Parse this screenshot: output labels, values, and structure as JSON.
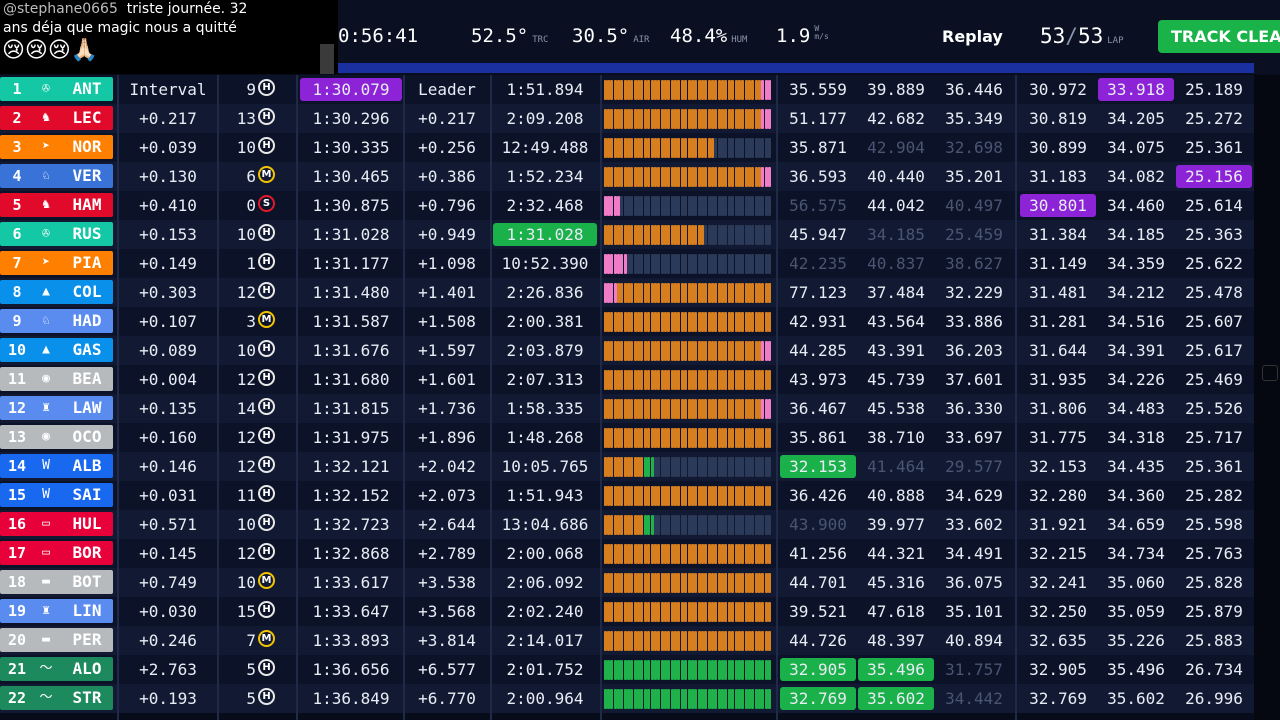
{
  "chat": {
    "user": "@stephane0665",
    "message_line1": "triste journée. 32",
    "message_line2": "ans déja que magic nous a quitté",
    "emojis": "😢😢😢🙏🏻"
  },
  "topbar": {
    "session_time": "0:56:41",
    "track_temp": "52.5°",
    "track_temp_unit": "TRC",
    "air_temp": "30.5°",
    "air_temp_unit": "AIR",
    "humidity": "48.4%",
    "humidity_unit": "HUM",
    "wind": "1.9",
    "wind_unit_top": "W",
    "wind_unit_bottom": "m/s",
    "mode_label": "Replay",
    "lap_current": "53",
    "lap_separator": "/",
    "lap_total": "53",
    "lap_unit": "LAP",
    "track_status_button": "TRACK CLEAR"
  },
  "colors": {
    "mercedes": "#14c8a6",
    "ferrari": "#e10a2a",
    "mclaren": "#ff8000",
    "redbull": "#3a73d8",
    "alpine": "#0890ea",
    "haas": "#b6babd",
    "racingbulls": "#5a8cf0",
    "williams": "#1868f0",
    "sauber": "#e8003a",
    "astonmartin": "#1d8a5e",
    "purple": "#8d23d6",
    "green": "#1ab04a",
    "mini_orange": "#d77f1f",
    "mini_pink": "#f07cc8",
    "mini_green": "#1fb24a",
    "mini_empty": "#2c3a5a",
    "tyre_hard": "#e8e8e8",
    "tyre_medium": "#f2c300",
    "tyre_soft": "#e01a2a"
  },
  "drivers": [
    {
      "pos": "1",
      "code": "ANT",
      "team": "mercedes",
      "logo": "✇",
      "interval": "Interval",
      "stint": "9",
      "tyre": "H",
      "best": "1:30.079",
      "best_hl": "purple",
      "gap": "Leader",
      "last": "1:51.894",
      "last_hl": "",
      "minis": "",
      "s1": "35.559",
      "s2": "39.889",
      "s3": "36.446",
      "s1_hl": "",
      "s2_hl": "",
      "s3_hl": "",
      "s1_f": false,
      "s2_f": false,
      "s3_f": false,
      "b1": "30.972",
      "b2": "33.918",
      "b3": "25.189",
      "b1_hl": "",
      "b2_hl": "purple",
      "b3_hl": ""
    },
    {
      "pos": "2",
      "code": "LEC",
      "team": "ferrari",
      "logo": "♞",
      "interval": "+0.217",
      "stint": "13",
      "tyre": "H",
      "best": "1:30.296",
      "best_hl": "",
      "gap": "+0.217",
      "last": "2:09.208",
      "last_hl": "",
      "minis": "",
      "s1": "51.177",
      "s2": "42.682",
      "s3": "35.349",
      "s1_hl": "",
      "s2_hl": "",
      "s3_hl": "",
      "s1_f": false,
      "s2_f": false,
      "s3_f": false,
      "b1": "30.819",
      "b2": "34.205",
      "b3": "25.272",
      "b1_hl": "",
      "b2_hl": "",
      "b3_hl": ""
    },
    {
      "pos": "3",
      "code": "NOR",
      "team": "mclaren",
      "logo": "➤",
      "interval": "+0.039",
      "stint": "10",
      "tyre": "H",
      "best": "1:30.335",
      "best_hl": "",
      "gap": "+0.256",
      "last": "12:49.488",
      "last_hl": "",
      "minis": "",
      "s1": "35.871",
      "s2": "42.904",
      "s3": "32.698",
      "s1_hl": "",
      "s2_hl": "",
      "s3_hl": "",
      "s1_f": false,
      "s2_f": true,
      "s3_f": true,
      "b1": "30.899",
      "b2": "34.075",
      "b3": "25.361",
      "b1_hl": "",
      "b2_hl": "",
      "b3_hl": ""
    },
    {
      "pos": "4",
      "code": "VER",
      "team": "redbull",
      "logo": "♘",
      "interval": "+0.130",
      "stint": "6",
      "tyre": "M",
      "best": "1:30.465",
      "best_hl": "",
      "gap": "+0.386",
      "last": "1:52.234",
      "last_hl": "",
      "minis": "",
      "s1": "36.593",
      "s2": "40.440",
      "s3": "35.201",
      "s1_hl": "",
      "s2_hl": "",
      "s3_hl": "",
      "s1_f": false,
      "s2_f": false,
      "s3_f": false,
      "b1": "31.183",
      "b2": "34.082",
      "b3": "25.156",
      "b1_hl": "",
      "b2_hl": "",
      "b3_hl": "purple"
    },
    {
      "pos": "5",
      "code": "HAM",
      "team": "ferrari",
      "logo": "♞",
      "interval": "+0.410",
      "stint": "0",
      "tyre": "S",
      "best": "1:30.875",
      "best_hl": "",
      "gap": "+0.796",
      "last": "2:32.468",
      "last_hl": "",
      "minis": "",
      "s1": "56.575",
      "s2": "44.042",
      "s3": "40.497",
      "s1_hl": "",
      "s2_hl": "",
      "s3_hl": "",
      "s1_f": true,
      "s2_f": false,
      "s3_f": true,
      "b1": "30.801",
      "b2": "34.460",
      "b3": "25.614",
      "b1_hl": "purple",
      "b2_hl": "",
      "b3_hl": ""
    },
    {
      "pos": "6",
      "code": "RUS",
      "team": "mercedes",
      "logo": "✇",
      "interval": "+0.153",
      "stint": "10",
      "tyre": "H",
      "best": "1:31.028",
      "best_hl": "",
      "gap": "+0.949",
      "last": "1:31.028",
      "last_hl": "green",
      "minis": "",
      "s1": "45.947",
      "s2": "34.185",
      "s3": "25.459",
      "s1_hl": "",
      "s2_hl": "",
      "s3_hl": "",
      "s1_f": false,
      "s2_f": true,
      "s3_f": true,
      "b1": "31.384",
      "b2": "34.185",
      "b3": "25.363",
      "b1_hl": "",
      "b2_hl": "",
      "b3_hl": ""
    },
    {
      "pos": "7",
      "code": "PIA",
      "team": "mclaren",
      "logo": "➤",
      "interval": "+0.149",
      "stint": "1",
      "tyre": "H",
      "best": "1:31.177",
      "best_hl": "",
      "gap": "+1.098",
      "last": "10:52.390",
      "last_hl": "",
      "minis": "",
      "s1": "42.235",
      "s2": "40.837",
      "s3": "38.627",
      "s1_hl": "",
      "s2_hl": "",
      "s3_hl": "",
      "s1_f": true,
      "s2_f": true,
      "s3_f": true,
      "b1": "31.149",
      "b2": "34.359",
      "b3": "25.622",
      "b1_hl": "",
      "b2_hl": "",
      "b3_hl": ""
    },
    {
      "pos": "8",
      "code": "COL",
      "team": "alpine",
      "logo": "▲",
      "interval": "+0.303",
      "stint": "12",
      "tyre": "H",
      "best": "1:31.480",
      "best_hl": "",
      "gap": "+1.401",
      "last": "2:26.836",
      "last_hl": "",
      "minis": "",
      "s1": "77.123",
      "s2": "37.484",
      "s3": "32.229",
      "s1_hl": "",
      "s2_hl": "",
      "s3_hl": "",
      "s1_f": false,
      "s2_f": false,
      "s3_f": false,
      "b1": "31.481",
      "b2": "34.212",
      "b3": "25.478",
      "b1_hl": "",
      "b2_hl": "",
      "b3_hl": ""
    },
    {
      "pos": "9",
      "code": "HAD",
      "team": "racingbulls",
      "logo": "♘",
      "interval": "+0.107",
      "stint": "3",
      "tyre": "M",
      "best": "1:31.587",
      "best_hl": "",
      "gap": "+1.508",
      "last": "2:00.381",
      "last_hl": "",
      "minis": "",
      "s1": "42.931",
      "s2": "43.564",
      "s3": "33.886",
      "s1_hl": "",
      "s2_hl": "",
      "s3_hl": "",
      "s1_f": false,
      "s2_f": false,
      "s3_f": false,
      "b1": "31.281",
      "b2": "34.516",
      "b3": "25.607",
      "b1_hl": "",
      "b2_hl": "",
      "b3_hl": ""
    },
    {
      "pos": "10",
      "code": "GAS",
      "team": "alpine",
      "logo": "▲",
      "interval": "+0.089",
      "stint": "10",
      "tyre": "H",
      "best": "1:31.676",
      "best_hl": "",
      "gap": "+1.597",
      "last": "2:03.879",
      "last_hl": "",
      "minis": "",
      "s1": "44.285",
      "s2": "43.391",
      "s3": "36.203",
      "s1_hl": "",
      "s2_hl": "",
      "s3_hl": "",
      "s1_f": false,
      "s2_f": false,
      "s3_f": false,
      "b1": "31.644",
      "b2": "34.391",
      "b3": "25.617",
      "b1_hl": "",
      "b2_hl": "",
      "b3_hl": ""
    },
    {
      "pos": "11",
      "code": "BEA",
      "team": "haas",
      "logo": "◉",
      "interval": "+0.004",
      "stint": "12",
      "tyre": "H",
      "best": "1:31.680",
      "best_hl": "",
      "gap": "+1.601",
      "last": "2:07.313",
      "last_hl": "",
      "minis": "",
      "s1": "43.973",
      "s2": "45.739",
      "s3": "37.601",
      "s1_hl": "",
      "s2_hl": "",
      "s3_hl": "",
      "s1_f": false,
      "s2_f": false,
      "s3_f": false,
      "b1": "31.935",
      "b2": "34.226",
      "b3": "25.469",
      "b1_hl": "",
      "b2_hl": "",
      "b3_hl": ""
    },
    {
      "pos": "12",
      "code": "LAW",
      "team": "racingbulls",
      "logo": "♜",
      "interval": "+0.135",
      "stint": "14",
      "tyre": "H",
      "best": "1:31.815",
      "best_hl": "",
      "gap": "+1.736",
      "last": "1:58.335",
      "last_hl": "",
      "minis": "",
      "s1": "36.467",
      "s2": "45.538",
      "s3": "36.330",
      "s1_hl": "",
      "s2_hl": "",
      "s3_hl": "",
      "s1_f": false,
      "s2_f": false,
      "s3_f": false,
      "b1": "31.806",
      "b2": "34.483",
      "b3": "25.526",
      "b1_hl": "",
      "b2_hl": "",
      "b3_hl": ""
    },
    {
      "pos": "13",
      "code": "OCO",
      "team": "haas",
      "logo": "◉",
      "interval": "+0.160",
      "stint": "12",
      "tyre": "H",
      "best": "1:31.975",
      "best_hl": "",
      "gap": "+1.896",
      "last": "1:48.268",
      "last_hl": "",
      "minis": "",
      "s1": "35.861",
      "s2": "38.710",
      "s3": "33.697",
      "s1_hl": "",
      "s2_hl": "",
      "s3_hl": "",
      "s1_f": false,
      "s2_f": false,
      "s3_f": false,
      "b1": "31.775",
      "b2": "34.318",
      "b3": "25.717",
      "b1_hl": "",
      "b2_hl": "",
      "b3_hl": ""
    },
    {
      "pos": "14",
      "code": "ALB",
      "team": "williams",
      "logo": "W",
      "interval": "+0.146",
      "stint": "12",
      "tyre": "H",
      "best": "1:32.121",
      "best_hl": "",
      "gap": "+2.042",
      "last": "10:05.765",
      "last_hl": "",
      "minis": "",
      "s1": "32.153",
      "s2": "41.464",
      "s3": "29.577",
      "s1_hl": "green",
      "s2_hl": "",
      "s3_hl": "",
      "s1_f": false,
      "s2_f": true,
      "s3_f": true,
      "b1": "32.153",
      "b2": "34.435",
      "b3": "25.361",
      "b1_hl": "",
      "b2_hl": "",
      "b3_hl": ""
    },
    {
      "pos": "15",
      "code": "SAI",
      "team": "williams",
      "logo": "W",
      "interval": "+0.031",
      "stint": "11",
      "tyre": "H",
      "best": "1:32.152",
      "best_hl": "",
      "gap": "+2.073",
      "last": "1:51.943",
      "last_hl": "",
      "minis": "",
      "s1": "36.426",
      "s2": "40.888",
      "s3": "34.629",
      "s1_hl": "",
      "s2_hl": "",
      "s3_hl": "",
      "s1_f": false,
      "s2_f": false,
      "s3_f": false,
      "b1": "32.280",
      "b2": "34.360",
      "b3": "25.282",
      "b1_hl": "",
      "b2_hl": "",
      "b3_hl": ""
    },
    {
      "pos": "16",
      "code": "HUL",
      "team": "sauber",
      "logo": "▭",
      "interval": "+0.571",
      "stint": "10",
      "tyre": "H",
      "best": "1:32.723",
      "best_hl": "",
      "gap": "+2.644",
      "last": "13:04.686",
      "last_hl": "",
      "minis": "",
      "s1": "43.900",
      "s2": "39.977",
      "s3": "33.602",
      "s1_hl": "",
      "s2_hl": "",
      "s3_hl": "",
      "s1_f": true,
      "s2_f": false,
      "s3_f": false,
      "b1": "31.921",
      "b2": "34.659",
      "b3": "25.598",
      "b1_hl": "",
      "b2_hl": "",
      "b3_hl": ""
    },
    {
      "pos": "17",
      "code": "BOR",
      "team": "sauber",
      "logo": "▭",
      "interval": "+0.145",
      "stint": "12",
      "tyre": "H",
      "best": "1:32.868",
      "best_hl": "",
      "gap": "+2.789",
      "last": "2:00.068",
      "last_hl": "",
      "minis": "",
      "s1": "41.256",
      "s2": "44.321",
      "s3": "34.491",
      "s1_hl": "",
      "s2_hl": "",
      "s3_hl": "",
      "s1_f": false,
      "s2_f": false,
      "s3_f": false,
      "b1": "32.215",
      "b2": "34.734",
      "b3": "25.763",
      "b1_hl": "",
      "b2_hl": "",
      "b3_hl": ""
    },
    {
      "pos": "18",
      "code": "BOT",
      "team": "haas",
      "logo": "▬",
      "interval": "+0.749",
      "stint": "10",
      "tyre": "M",
      "best": "1:33.617",
      "best_hl": "",
      "gap": "+3.538",
      "last": "2:06.092",
      "last_hl": "",
      "minis": "",
      "s1": "44.701",
      "s2": "45.316",
      "s3": "36.075",
      "s1_hl": "",
      "s2_hl": "",
      "s3_hl": "",
      "s1_f": false,
      "s2_f": false,
      "s3_f": false,
      "b1": "32.241",
      "b2": "35.060",
      "b3": "25.828",
      "b1_hl": "",
      "b2_hl": "",
      "b3_hl": ""
    },
    {
      "pos": "19",
      "code": "LIN",
      "team": "racingbulls",
      "logo": "♜",
      "interval": "+0.030",
      "stint": "15",
      "tyre": "H",
      "best": "1:33.647",
      "best_hl": "",
      "gap": "+3.568",
      "last": "2:02.240",
      "last_hl": "",
      "minis": "",
      "s1": "39.521",
      "s2": "47.618",
      "s3": "35.101",
      "s1_hl": "",
      "s2_hl": "",
      "s3_hl": "",
      "s1_f": false,
      "s2_f": false,
      "s3_f": false,
      "b1": "32.250",
      "b2": "35.059",
      "b3": "25.879",
      "b1_hl": "",
      "b2_hl": "",
      "b3_hl": ""
    },
    {
      "pos": "20",
      "code": "PER",
      "team": "haas",
      "logo": "▬",
      "interval": "+0.246",
      "stint": "7",
      "tyre": "M",
      "best": "1:33.893",
      "best_hl": "",
      "gap": "+3.814",
      "last": "2:14.017",
      "last_hl": "",
      "minis": "",
      "s1": "44.726",
      "s2": "48.397",
      "s3": "40.894",
      "s1_hl": "",
      "s2_hl": "",
      "s3_hl": "",
      "s1_f": false,
      "s2_f": false,
      "s3_f": false,
      "b1": "32.635",
      "b2": "35.226",
      "b3": "25.883",
      "b1_hl": "",
      "b2_hl": "",
      "b3_hl": ""
    },
    {
      "pos": "21",
      "code": "ALO",
      "team": "astonmartin",
      "logo": "〜",
      "interval": "+2.763",
      "stint": "5",
      "tyre": "H",
      "best": "1:36.656",
      "best_hl": "",
      "gap": "+6.577",
      "last": "2:01.752",
      "last_hl": "",
      "minis": "",
      "s1": "32.905",
      "s2": "35.496",
      "s3": "31.757",
      "s1_hl": "green",
      "s2_hl": "green",
      "s3_hl": "",
      "s1_f": false,
      "s2_f": false,
      "s3_f": true,
      "b1": "32.905",
      "b2": "35.496",
      "b3": "26.734",
      "b1_hl": "",
      "b2_hl": "",
      "b3_hl": ""
    },
    {
      "pos": "22",
      "code": "STR",
      "team": "astonmartin",
      "logo": "〜",
      "interval": "+0.193",
      "stint": "5",
      "tyre": "H",
      "best": "1:36.849",
      "best_hl": "",
      "gap": "+6.770",
      "last": "2:00.964",
      "last_hl": "",
      "minis": "",
      "s1": "32.769",
      "s2": "35.602",
      "s3": "34.442",
      "s1_hl": "green",
      "s2_hl": "green",
      "s3_hl": "",
      "s1_f": false,
      "s2_f": false,
      "s3_f": true,
      "b1": "32.769",
      "b2": "35.602",
      "b3": "26.996",
      "b1_hl": "",
      "b2_hl": "",
      "b3_hl": ""
    }
  ],
  "minisectors": [
    "oooooooooooooooooooooooooooooooooooooooooooooooppp",
    "oooooooooooooooooooooooooooooooooooooooooooooooppp",
    "ooooooooooooooooooooooooooooooooo-----------------",
    "oooooooooooooooooooooooooooooooooooooooooooooooppp",
    "ppppp---------------------------------------------",
    "oooooooooooooooooooooooooooooo--------------------",
    "ppppppp-------------------------------------------",
    "ppppoooooooooooooooooooooooooooooooooooooooooooooo",
    "oooooooooooooooooooooooooooooooooooooooooooooooooo",
    "oooooooooooooooooooooooooooooooooooooooooooooooppp",
    "oooooooooooooooooooooooooooooooooooooooooooooooooo",
    "oooooooooooooooooooooooooooooooooooooooooooooooppp",
    "oooooooooooooooooooooooooooooooooooooooooooooooooo",
    "ooooooooooooggg-----------------------------------",
    "oooooooooooooooooooooooooooooooooooooooooooooooooo",
    "ooooooooooooggg-----------------------------------",
    "oooooooooooooooooooooooooooooooooooooooooooooooooo",
    "oooooooooooooooooooooooooooooooooooooooooooooooooo",
    "oooooooooooooooooooooooooooooooooooooooooooooooooo",
    "oooooooooooooooooooooooooooooooooooooooooooooooooo",
    "gggggggggggggggggggggggggggggggggggggggggggggggggg",
    "gggggggggggggggggggggggggggggggggggggggggggggggggg"
  ]
}
